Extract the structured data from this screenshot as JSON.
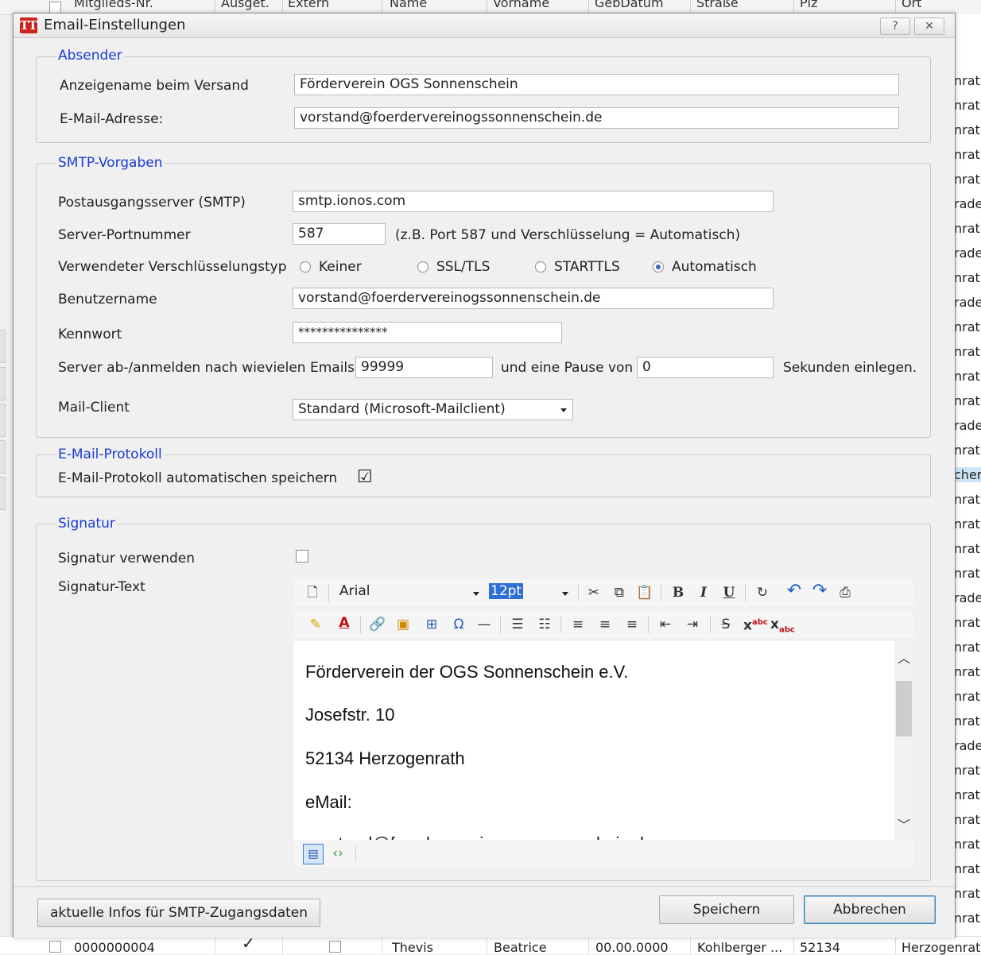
{
  "background_grid": {
    "columns": [
      "Mitglieds-Nr.",
      "Ausget.",
      "Extern",
      "Name",
      "Vorname",
      "GebDatum",
      "Straße",
      "Plz",
      "Ort"
    ],
    "right_cells": [
      "nrat",
      "nrat",
      "nrat",
      "nrat",
      "nrat",
      "rade",
      "nrat",
      "rade",
      "nrat",
      "rade",
      "nrat",
      "nrat",
      "nrat",
      "nrat",
      "rade",
      "nrat",
      "cher",
      "nrat",
      "nrat",
      "nrat",
      "nrat",
      "rade",
      "nrat",
      "nrat",
      "nrat",
      "nrat",
      "nrat",
      "rade",
      "nrat",
      "nrat",
      "nrat",
      "nrat",
      "nrat",
      "nrat",
      "nrat"
    ],
    "bottom_row": {
      "nr": "0000000004",
      "name": "Thevis",
      "vorname": "Beatrice",
      "gebdatum": "00.00.0000",
      "strasse": "Kohlberger ...",
      "plz": "52134",
      "ort": "Herzogenrath"
    }
  },
  "dialog": {
    "title": "Email-Einstellungen",
    "help_label": "?",
    "close_label": "✕",
    "absender": {
      "legend": "Absender",
      "anzeigename_label": "Anzeigename beim Versand",
      "anzeigename_value": "Förderverein OGS Sonnenschein",
      "email_label": "E-Mail-Adresse:",
      "email_value": "vorstand@foerdervereinogssonnenschein.de"
    },
    "smtp": {
      "legend": "SMTP-Vorgaben",
      "server_label": "Postausgangsserver (SMTP)",
      "server_value": "smtp.ionos.com",
      "port_label": "Server-Portnummer",
      "port_value": "587",
      "port_hint": "(z.B. Port 587 und Verschlüsselung = Automatisch)",
      "encryption_label": "Verwendeter Verschlüsselungstyp",
      "encryption_options": [
        "Keiner",
        "SSL/TLS",
        "STARTTLS",
        "Automatisch"
      ],
      "encryption_selected": "Automatisch",
      "user_label": "Benutzername",
      "user_value": "vorstand@foerdervereinogssonnenschein.de",
      "password_label": "Kennwort",
      "password_value": "***************",
      "relogin_label": "Server ab-/anmelden nach wievielen Emails?",
      "relogin_value": "99999",
      "pause_label": "und eine Pause von",
      "pause_value": "0",
      "pause_suffix": "Sekunden einlegen.",
      "mailclient_label": "Mail-Client",
      "mailclient_value": "Standard (Microsoft-Mailclient)"
    },
    "protokoll": {
      "legend": "E-Mail-Protokoll",
      "auto_save_label": "E-Mail-Protokoll automatischen speichern",
      "auto_save_checked": true
    },
    "signatur": {
      "legend": "Signatur",
      "use_label": "Signatur verwenden",
      "use_checked": false,
      "text_label": "Signatur-Text",
      "font_value": "Arial",
      "size_value": "12pt",
      "lines": [
        "Förderverein der OGS Sonnenschein e.V.",
        "Josefstr. 10",
        "52134 Herzogenrath",
        "eMail:",
        "vorstand@foerdervereinogssonnenschein.de"
      ]
    },
    "buttons": {
      "info": "aktuelle Infos für SMTP-Zugangsdaten",
      "save": "Speichern",
      "cancel": "Abbrechen"
    }
  }
}
